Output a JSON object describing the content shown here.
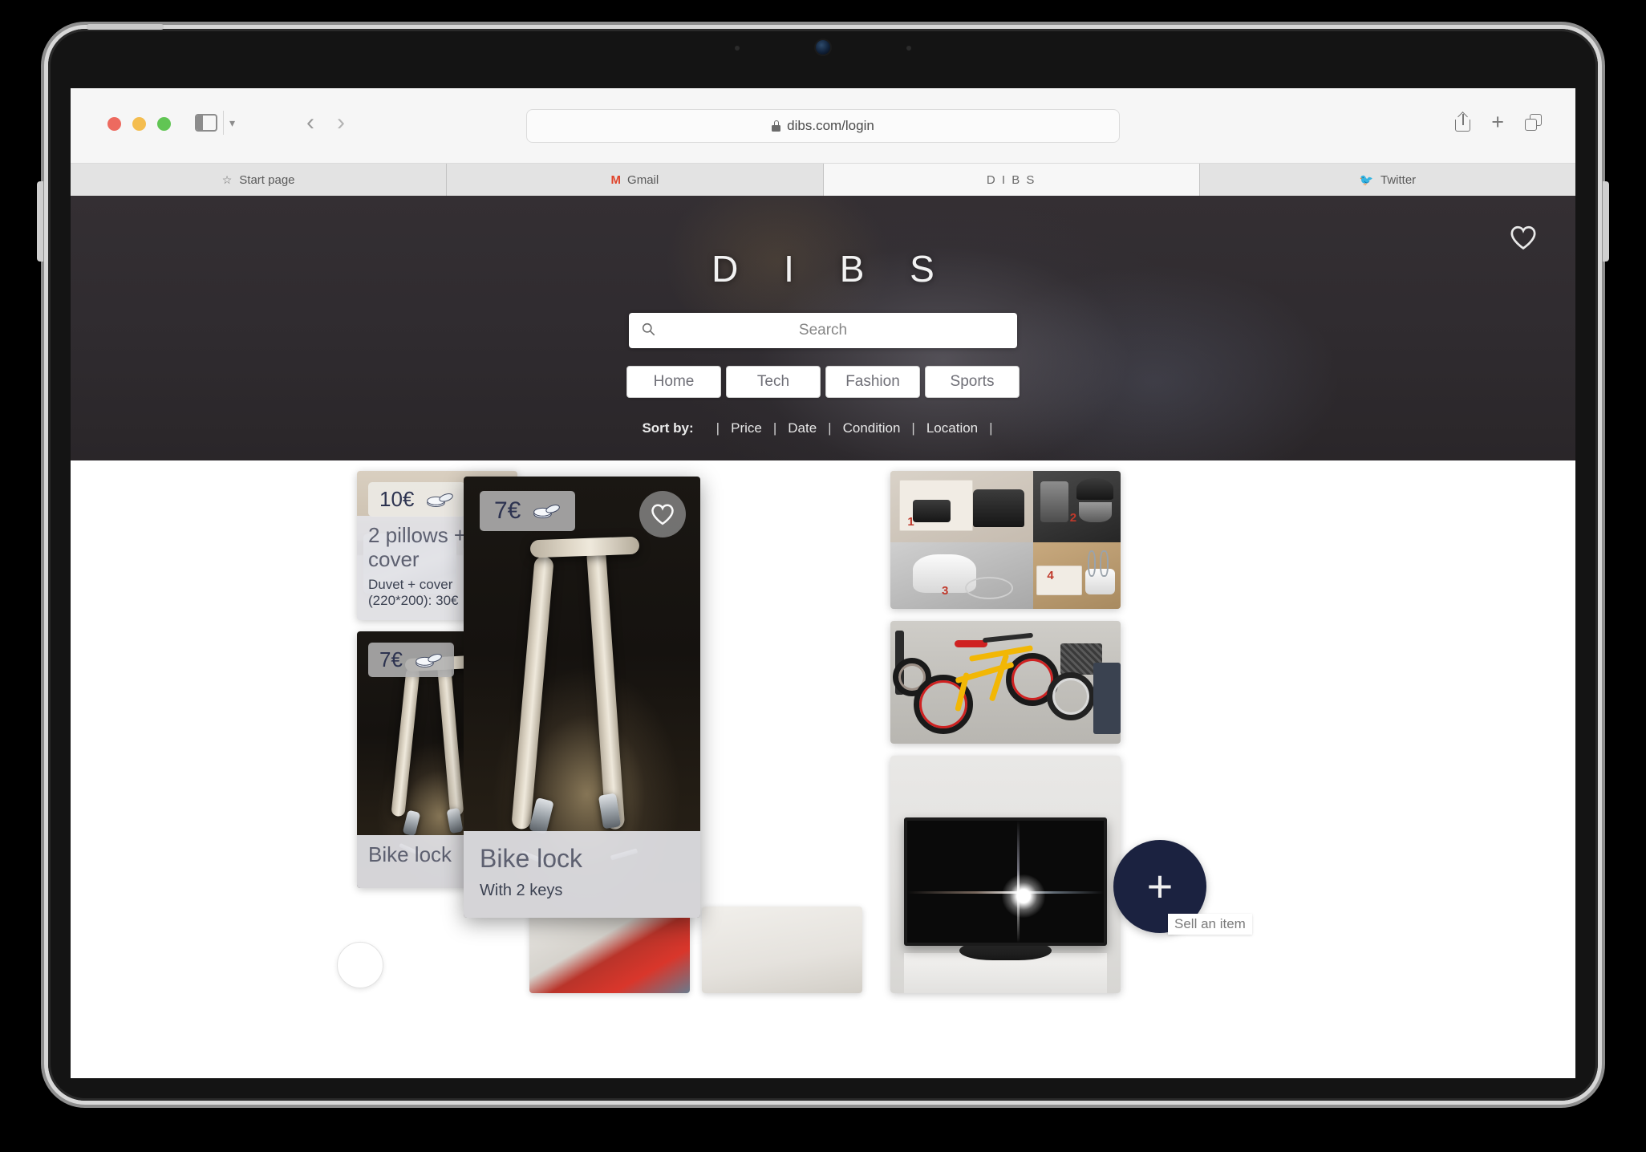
{
  "browser": {
    "address": {
      "url": "dibs.com/login",
      "lock_icon": "lock-icon"
    },
    "window_controls": [
      "close",
      "minimize",
      "maximize"
    ],
    "toolbar_icons": [
      "sidebar-toggle-icon",
      "chevron-down-icon",
      "back-arrow-icon",
      "forward-arrow-icon",
      "share-icon",
      "new-tab-icon",
      "tab-overview-icon"
    ],
    "tabs": [
      {
        "label": "Start page",
        "icon": "star-icon",
        "active": false
      },
      {
        "label": "Gmail",
        "icon": "gmail-icon",
        "active": false
      },
      {
        "label": "D I B S",
        "icon": "",
        "active": true
      },
      {
        "label": "Twitter",
        "icon": "twitter-icon",
        "active": false
      }
    ]
  },
  "site": {
    "title": "D I B S",
    "favorites_icon": "heart-icon",
    "search": {
      "placeholder": "Search",
      "value": "",
      "icon": "search-icon"
    },
    "categories": [
      {
        "label": "Home"
      },
      {
        "label": "Tech"
      },
      {
        "label": "Fashion"
      },
      {
        "label": "Sports"
      }
    ],
    "sort": {
      "label": "Sort by:",
      "options": [
        "Price",
        "Date",
        "Condition",
        "Location"
      ],
      "separator": "|"
    }
  },
  "listings": [
    {
      "id": "pillows",
      "price": "10€",
      "price_icon": "coins-icon",
      "title": "2 pillows + cover",
      "subtitle": "Duvet + cover (220*200): 30€",
      "photo": "bedding-photo"
    },
    {
      "id": "bikelock-small",
      "price": "7€",
      "price_icon": "coins-icon",
      "title": "Bike lock",
      "subtitle": "",
      "photo": "bike-lock-photo"
    },
    {
      "id": "bikelock-expanded",
      "price": "7€",
      "price_icon": "coins-icon",
      "title": "Bike lock",
      "subtitle": "With 2 keys",
      "photo": "bike-lock-photo",
      "favorite_icon": "heart-icon"
    },
    {
      "id": "appliances",
      "price": "",
      "title": "",
      "subtitle": "",
      "photo": "kitchen-appliances-photo",
      "photo_labels": [
        "1",
        "2",
        "3",
        "4"
      ]
    },
    {
      "id": "bicycle",
      "price": "",
      "title": "",
      "subtitle": "",
      "photo": "yellow-bicycle-photo"
    },
    {
      "id": "television",
      "price": "",
      "title": "",
      "subtitle": "",
      "photo": "flatscreen-tv-photo"
    }
  ],
  "fab": {
    "icon": "plus-icon",
    "tooltip": "Sell an item"
  },
  "colors": {
    "header_dark": "#2f2b2f",
    "fab_navy": "#1b2240",
    "price_text": "#2d3350",
    "card_caption": "#e2e2e6",
    "tab_active": "#f7f7f7"
  }
}
